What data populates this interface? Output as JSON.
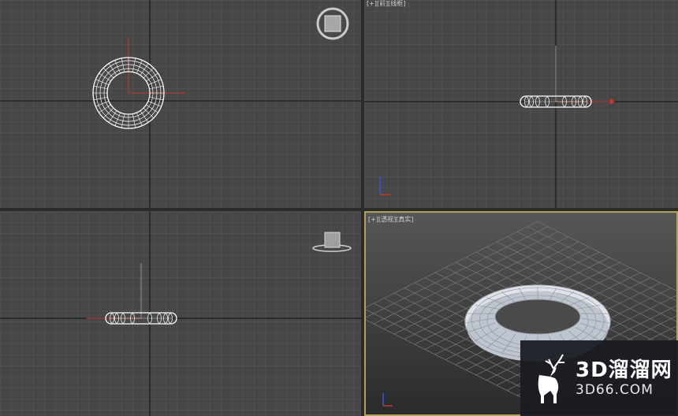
{
  "viewports": {
    "top_label": "",
    "front_label": "[+][前][线框]",
    "left_label": "",
    "perspective_label": "[+][透视][真实]"
  },
  "object": {
    "name": "torus",
    "color": "#ffffff"
  },
  "axis_colors": {
    "x": "#d0392b",
    "y": "#2d9b3a",
    "z": "#3a55d6"
  },
  "watermark": {
    "brand_cn": "3D溜溜网",
    "url": "3D66.COM",
    "logo": "deer-icon"
  }
}
